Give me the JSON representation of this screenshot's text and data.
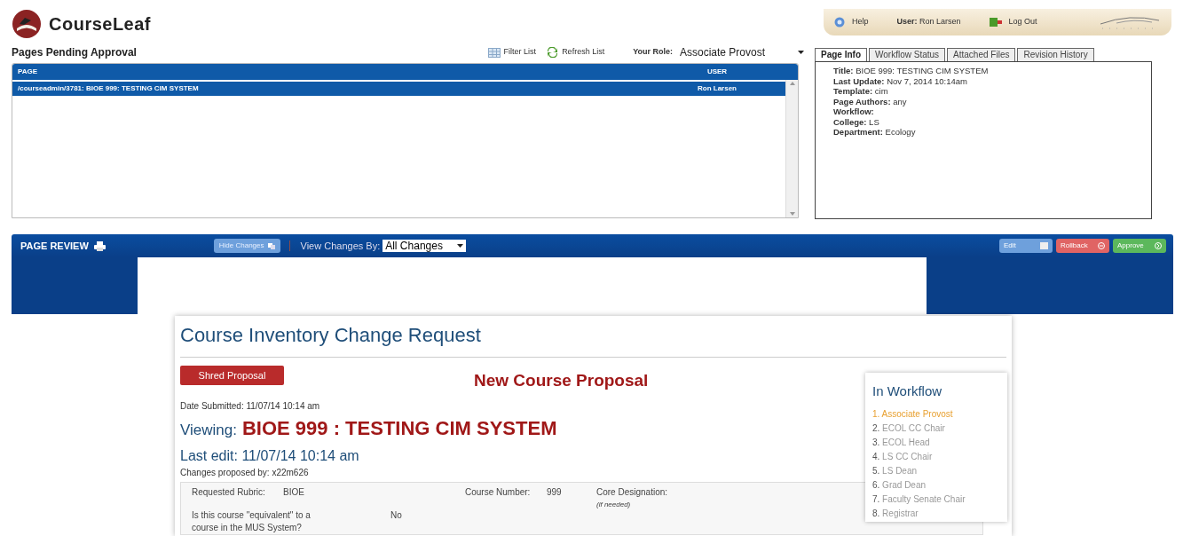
{
  "app": {
    "title": "CourseLeaf"
  },
  "top_bar": {
    "help": "Help",
    "user_label": "User:",
    "user": "Ron Larsen",
    "logout": "Log Out"
  },
  "pending": {
    "title": "Pages Pending Approval",
    "filter": "Filter List",
    "refresh": "Refresh List",
    "role_label": "Your Role:",
    "role": "Associate Provost",
    "columns": [
      "PAGE",
      "USER"
    ],
    "rows": [
      {
        "page": "/courseadmin/3781: BIOE 999: TESTING CIM SYSTEM",
        "user": "Ron Larsen",
        "selected": true
      }
    ]
  },
  "info_tabs": [
    {
      "label": "Page Info",
      "selected": true
    },
    {
      "label": "Workflow Status",
      "selected": false
    },
    {
      "label": "Attached Files",
      "selected": false
    },
    {
      "label": "Revision History",
      "selected": false
    }
  ],
  "page_info": [
    "**Title:** BIOE 999: TESTING CIM SYSTEM",
    "**Last Update:** Nov 7, 2014 10:14am",
    "**Template:** cim",
    "**Page Authors:** any",
    "**Workflow:**",
    "**College:** LS",
    "**Department:** Ecology"
  ],
  "review_bar": {
    "title": "PAGE REVIEW",
    "hide_changes": "Hide Changes",
    "view_by_label": "View Changes By:",
    "view_by": "All Changes",
    "actions": [
      {
        "label": "Edit",
        "kind": "edit"
      },
      {
        "label": "Rollback",
        "kind": "rollback"
      },
      {
        "label": "Approve",
        "kind": "approve"
      }
    ]
  },
  "form": {
    "title": "Course Inventory Change Request",
    "shred": "Shred Proposal",
    "proposal_type": "New Course Proposal",
    "date_submitted": "Date Submitted: 11/07/14 10:14 am",
    "viewing_label": "Viewing:",
    "viewing": "BIOE 999 : TESTING CIM SYSTEM",
    "last_edit": "Last edit: 11/07/14 10:14 am",
    "proposed_by": "Changes proposed by: x22m626",
    "fields": [
      {
        "label": "Requested Rubric:",
        "value": "BIOE"
      },
      {
        "label": "Course Number:",
        "value": "999"
      },
      {
        "label": "Core Designation:",
        "note": "(if needed)"
      },
      {
        "label": "Is this course \"equivalent\" to a course in the MUS System?",
        "value": "No"
      }
    ]
  },
  "workflow": {
    "title": "In Workflow",
    "steps": [
      {
        "number": "1.",
        "label": "Associate Provost",
        "selected": true
      },
      {
        "number": "2.",
        "label": "ECOL CC Chair",
        "selected": false
      },
      {
        "number": "3.",
        "label": "ECOL Head",
        "selected": false
      },
      {
        "number": "4.",
        "label": "LS CC Chair",
        "selected": false
      },
      {
        "number": "5.",
        "label": "LS Dean",
        "selected": false
      },
      {
        "number": "6.",
        "label": "Grad Dean",
        "selected": false
      },
      {
        "number": "7.",
        "label": "Faculty Senate Chair",
        "selected": false
      },
      {
        "number": "8.",
        "label": "Registrar",
        "selected": false
      }
    ]
  }
}
